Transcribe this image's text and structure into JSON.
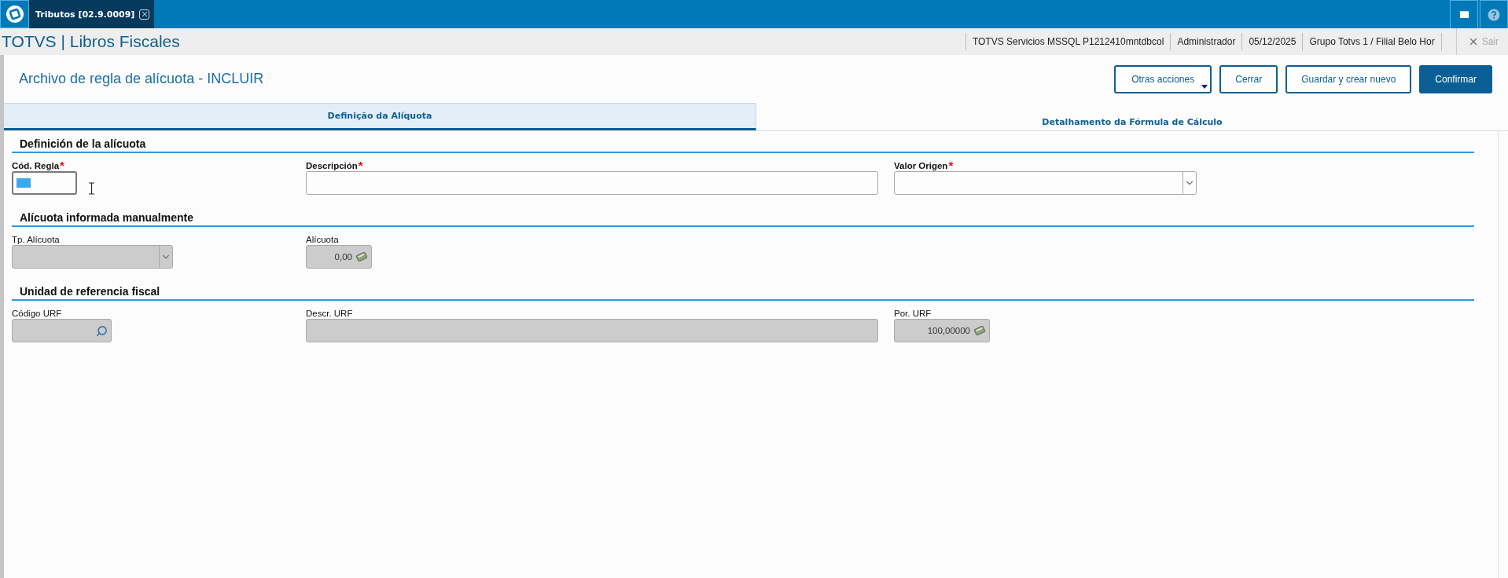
{
  "app_tabs": [
    {
      "label": "Tributos [02.9.0009]",
      "selected": true
    }
  ],
  "header": {
    "title": "TOTVS | Libros Fiscales",
    "info": [
      "TOTVS Servicios MSSQL P1212410mntdbcol",
      "Administrador",
      "05/12/2025",
      "Grupo Totvs 1 / Filial Belo Hor"
    ],
    "exit": "Sair"
  },
  "required_marker": "*",
  "page_title": "Archivo de regla de alícuota - INCLUIR",
  "buttons": [
    {
      "label": "Otras acciones",
      "kind": "menu"
    },
    {
      "label": "Cerrar",
      "kind": "outline"
    },
    {
      "label": "Guardar y crear nuevo",
      "kind": "outline"
    },
    {
      "label": "Confirmar",
      "kind": "primary"
    }
  ],
  "form_tabs": [
    {
      "label": "Definição da Alíquota",
      "selected": true
    },
    {
      "label": "Detalhamento da Fórmula de Cálculo",
      "selected": false
    }
  ],
  "sections": [
    {
      "title": "Definición de la alícuota",
      "fields": [
        {
          "label": "Cód. Regla",
          "kind": "text",
          "required": true,
          "disabled": false,
          "focused": true
        },
        {
          "label": "Descripción",
          "kind": "text",
          "required": true,
          "disabled": false,
          "focused": false
        },
        {
          "label": "Valor Origen",
          "kind": "select",
          "required": true,
          "disabled": false,
          "focused": false
        }
      ]
    },
    {
      "title": "Alícuota informada manualmente",
      "fields": [
        {
          "label": "Tp. Alícuota",
          "kind": "select",
          "required": false,
          "disabled": true,
          "focused": false
        },
        {
          "label": "Alícuota",
          "kind": "number",
          "value": "0,00",
          "required": false,
          "disabled": true,
          "focused": false
        }
      ]
    },
    {
      "title": "Unidad de referencia fiscal",
      "fields": [
        {
          "label": "Código URF",
          "kind": "lookup",
          "required": false,
          "disabled": true,
          "focused": false
        },
        {
          "label": "Descr. URF",
          "kind": "text",
          "required": false,
          "disabled": true,
          "focused": false
        },
        {
          "label": "Por. URF",
          "kind": "number",
          "value": "100,00000",
          "required": false,
          "disabled": true,
          "focused": false
        }
      ]
    }
  ]
}
